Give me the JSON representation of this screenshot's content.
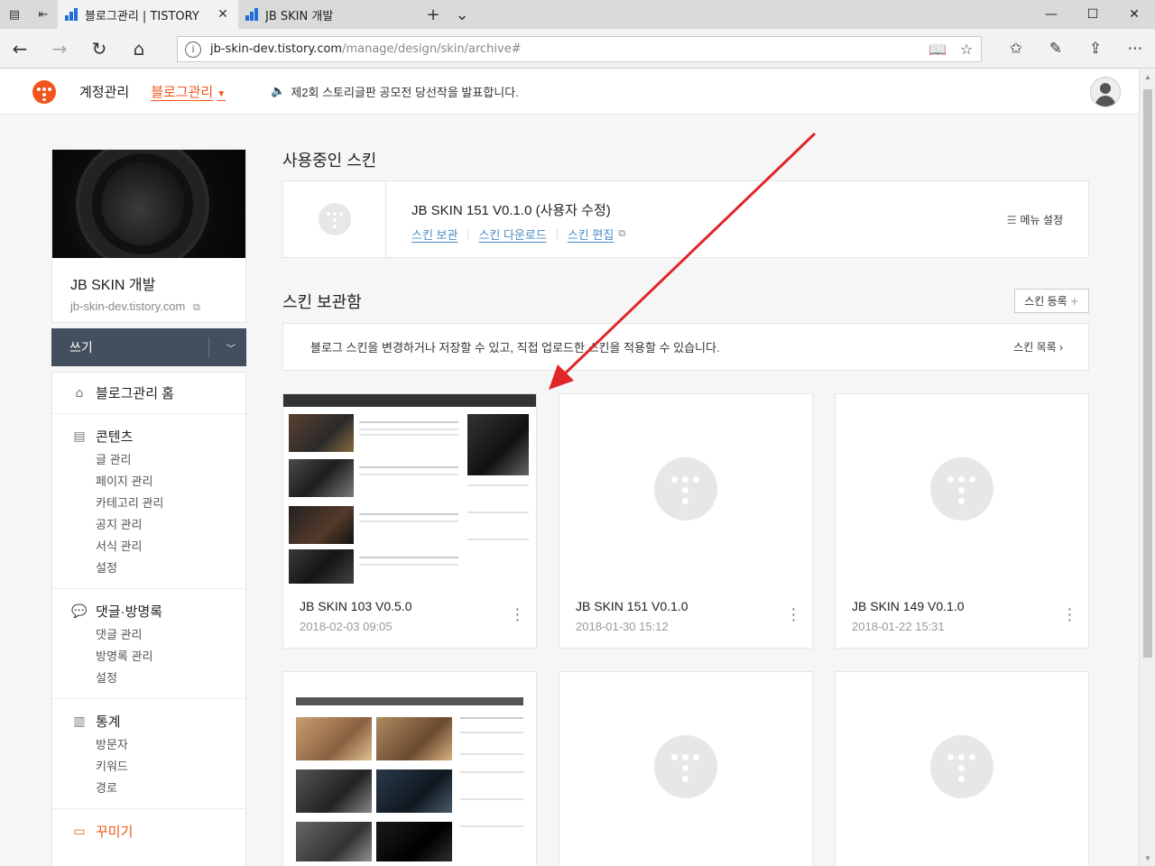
{
  "browser": {
    "tabs": [
      {
        "title": "블로그관리 | TISTORY",
        "active": true
      },
      {
        "title": "JB SKIN 개발",
        "active": false
      }
    ],
    "url_host": "jb-skin-dev.tistory.com",
    "url_path": "/manage/design/skin/archive#"
  },
  "header": {
    "account": "계정관리",
    "blog_manage": "블로그관리",
    "notice": "제2회 스토리글판 공모전 당선작을 발표합니다."
  },
  "sidebar": {
    "blog_name": "JB SKIN 개발",
    "blog_url": "jb-skin-dev.tistory.com",
    "write": "쓰기",
    "sections": [
      {
        "title": "블로그관리 홈",
        "items": []
      },
      {
        "title": "콘텐츠",
        "items": [
          "글 관리",
          "페이지 관리",
          "카테고리 관리",
          "공지 관리",
          "서식 관리",
          "설정"
        ]
      },
      {
        "title": "댓글·방명록",
        "items": [
          "댓글 관리",
          "방명록 관리",
          "설정"
        ]
      },
      {
        "title": "통계",
        "items": [
          "방문자",
          "키워드",
          "경로"
        ]
      },
      {
        "title": "꾸미기",
        "items": []
      }
    ]
  },
  "current_skin": {
    "section_title": "사용중인 스킨",
    "name": "JB SKIN 151 V0.1.0 (사용자 수정)",
    "links": [
      "스킨 보관",
      "스킨 다운로드",
      "스킨 편집"
    ],
    "menu_setting": "메뉴 설정"
  },
  "archive": {
    "section_title": "스킨 보관함",
    "register": "스킨 등록",
    "info": "블로그 스킨을 변경하거나 저장할 수 있고, 직접 업로드한 스킨을 적용할 수 있습니다.",
    "list_link": "스킨 목록",
    "cards": [
      {
        "name": "JB SKIN 103 V0.5.0",
        "date": "2018-02-03 09:05"
      },
      {
        "name": "JB SKIN 151 V0.1.0",
        "date": "2018-01-30 15:12"
      },
      {
        "name": "JB SKIN 149 V0.1.0",
        "date": "2018-01-22 15:31"
      }
    ]
  },
  "colors": {
    "accent": "#f2541b",
    "link": "#4a8bc6",
    "write_bg": "#434f5e",
    "arrow": "#e0262a"
  }
}
